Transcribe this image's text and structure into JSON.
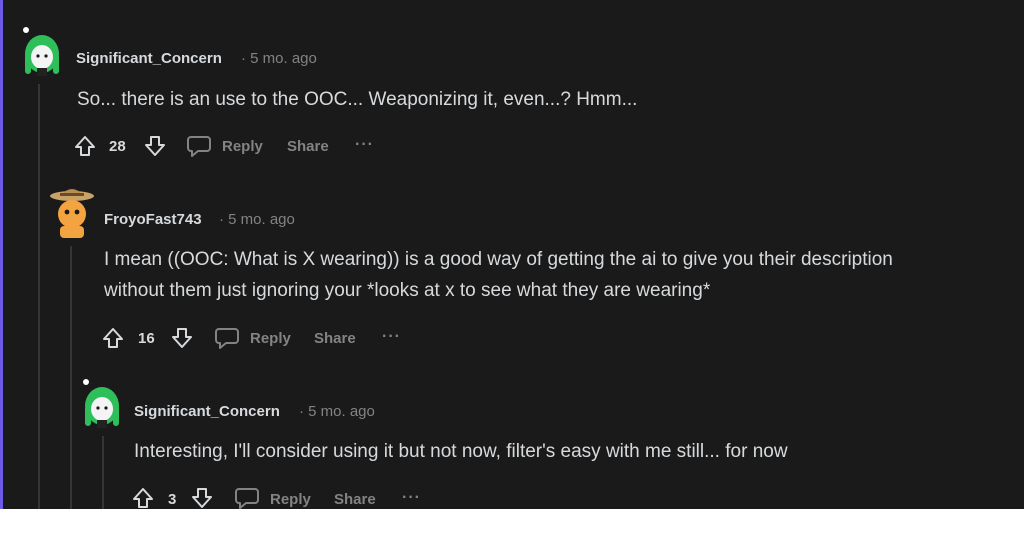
{
  "comments": [
    {
      "author": "Significant_Concern",
      "meta": "· 5 mo. ago",
      "body": [
        "So... there is an use to the OOC... Weaponizing it, even...? Hmm..."
      ],
      "votes": "28",
      "reply_label": "Reply",
      "share_label": "Share",
      "more_label": "···"
    },
    {
      "author": "FroyoFast743",
      "meta": "· 5 mo. ago",
      "body": [
        "I mean ((OOC: What is X wearing)) is a good way of getting the ai to give you their description",
        "without them just ignoring your *looks at x to see what they are wearing*"
      ],
      "votes": "16",
      "reply_label": "Reply",
      "share_label": "Share",
      "more_label": "···"
    },
    {
      "author": "Significant_Concern",
      "meta": "· 5 mo. ago",
      "body": [
        "Interesting, I'll consider using it but not now, filter's easy with me still... for now"
      ],
      "votes": "3",
      "reply_label": "Reply",
      "share_label": "Share",
      "more_label": "···"
    }
  ],
  "colors": {
    "background": "#1a1a1b",
    "text": "#d7dadc",
    "muted": "#818384",
    "thread_line": "#343536",
    "accent": "#6d5ae6"
  }
}
